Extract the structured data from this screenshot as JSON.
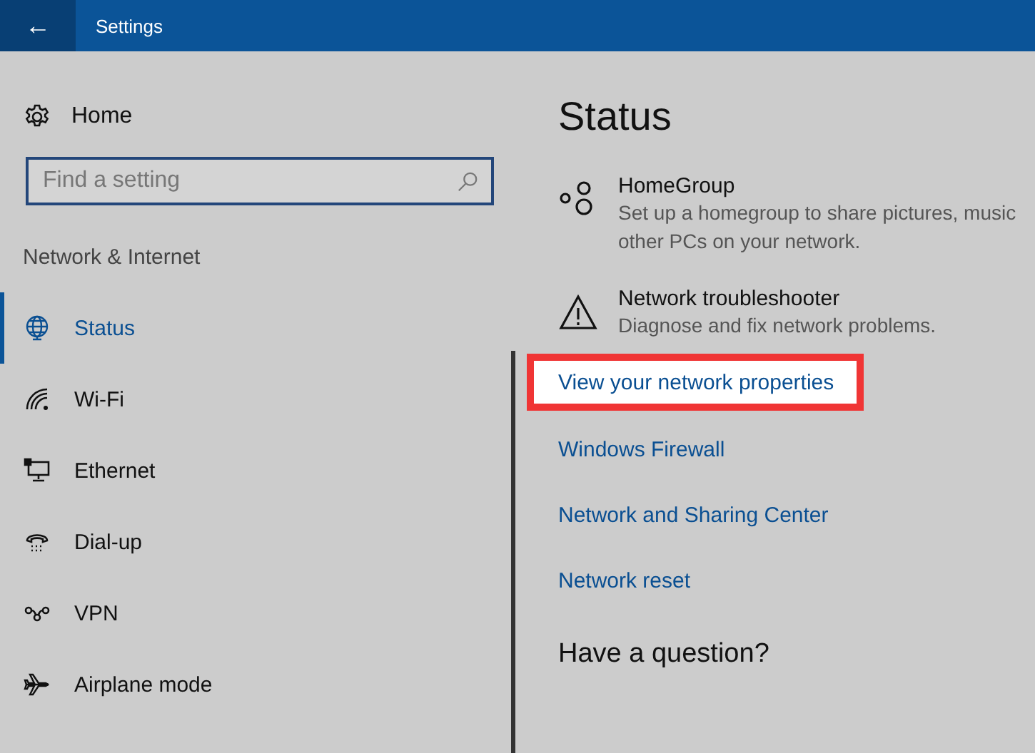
{
  "window": {
    "title": "Settings",
    "back_icon": "←"
  },
  "sidebar": {
    "home": "Home",
    "search": {
      "placeholder": "Find a setting"
    },
    "section": "Network & Internet",
    "items": [
      {
        "label": "Status",
        "selected": true
      },
      {
        "label": "Wi-Fi",
        "selected": false
      },
      {
        "label": "Ethernet",
        "selected": false
      },
      {
        "label": "Dial-up",
        "selected": false
      },
      {
        "label": "VPN",
        "selected": false
      },
      {
        "label": "Airplane mode",
        "selected": false
      }
    ]
  },
  "main": {
    "heading": "Status",
    "entries": [
      {
        "title": "HomeGroup",
        "description": "Set up a homegroup to share pictures, music",
        "description_2": "other PCs on your network."
      },
      {
        "title": "Network troubleshooter",
        "description": "Diagnose and fix network problems."
      }
    ],
    "links": [
      {
        "label": "View your network properties",
        "highlighted": true
      },
      {
        "label": "Windows Firewall",
        "highlighted": false
      },
      {
        "label": "Network and Sharing Center",
        "highlighted": false
      },
      {
        "label": "Network reset",
        "highlighted": false
      }
    ],
    "question": "Have a question?"
  }
}
